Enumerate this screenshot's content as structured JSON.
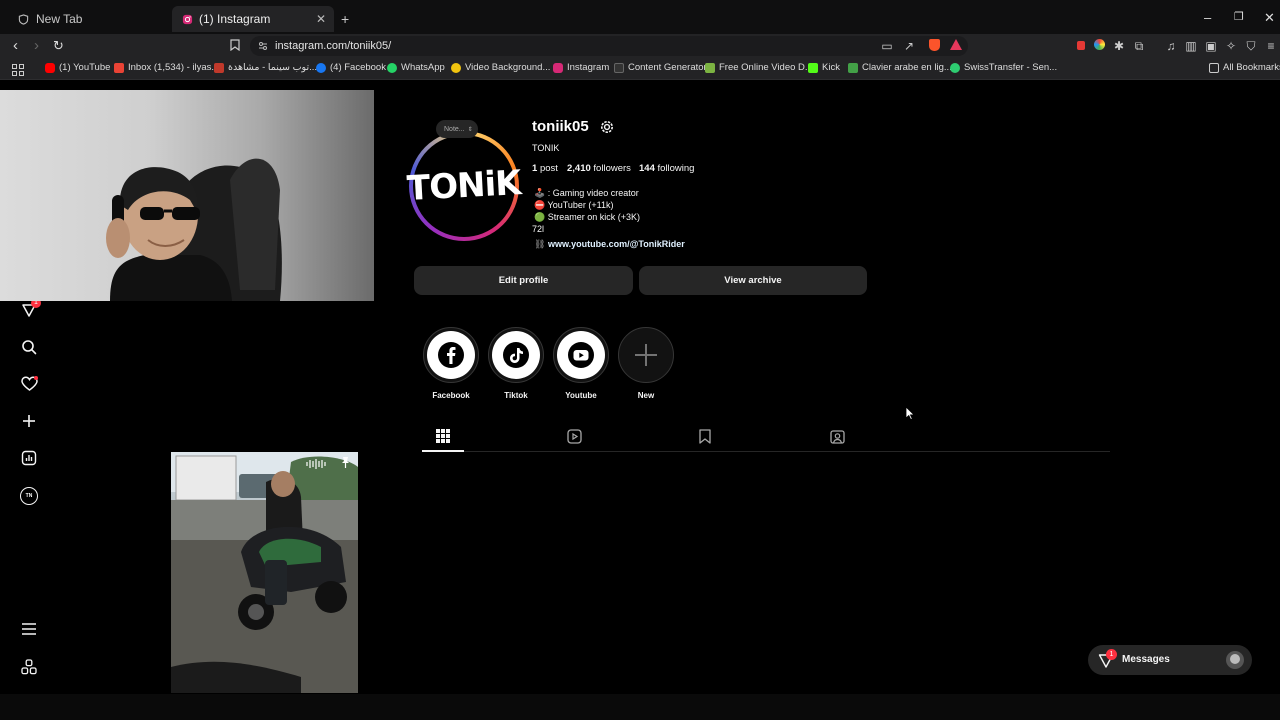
{
  "browser": {
    "tabs": [
      {
        "label": "New Tab",
        "icon": "shield-icon"
      },
      {
        "label": "(1) Instagram",
        "icon": "instagram-icon",
        "active": true
      }
    ],
    "url": "instagram.com/toniik05/",
    "bookmarks": [
      {
        "label": "(1) YouTube",
        "color": "#ff0000"
      },
      {
        "label": "Inbox (1,534) - ilyas...",
        "color": "#ea4335"
      },
      {
        "label": "توب سينما - مشاهدة...",
        "color": "#c0392b"
      },
      {
        "label": "(4) Facebook",
        "color": "#1877f2"
      },
      {
        "label": "WhatsApp",
        "color": "#25d366"
      },
      {
        "label": "Video Background...",
        "color": "#f1c40f"
      },
      {
        "label": "Instagram",
        "color": "#d62976"
      },
      {
        "label": "Content Generator",
        "color": "#333333"
      },
      {
        "label": "Free Online Video D...",
        "color": "#7cb342"
      },
      {
        "label": "Kick",
        "color": "#53fc18"
      },
      {
        "label": "Clavier arabe en lig...",
        "color": "#43a047"
      },
      {
        "label": "SwissTransfer - Sen...",
        "color": "#2ecc71"
      }
    ],
    "all_bookmarks": "All Bookmarks"
  },
  "nav": {
    "notifications_badge": "1",
    "items": [
      "reels-icon",
      "search-icon",
      "heart-icon",
      "create-icon",
      "dashboard-icon",
      "profile-icon",
      "menu-icon",
      "threads-icon"
    ]
  },
  "profile": {
    "note": "Note...",
    "avatar_text": "TONiK",
    "username": "toniik05",
    "full_name": "TONIK",
    "stats": {
      "posts_count": "1",
      "posts_label": "post",
      "followers_count": "2,410",
      "followers_label": "followers",
      "following_count": "144",
      "following_label": "following"
    },
    "bio": [
      "🕹️ : Gaming video creator",
      "⛔ YouTuber (+11k)",
      "🟢 Streamer on kick (+3K)",
      "72l"
    ],
    "link": "www.youtube.com/@TonikRider",
    "edit_button": "Edit profile",
    "archive_button": "View archive"
  },
  "highlights": [
    {
      "label": "Facebook",
      "icon": "facebook-icon"
    },
    {
      "label": "Tiktok",
      "icon": "tiktok-icon"
    },
    {
      "label": "Youtube",
      "icon": "youtube-icon"
    },
    {
      "label": "New",
      "icon": "plus-icon"
    }
  ],
  "messages": {
    "label": "Messages",
    "badge": "1"
  },
  "colors": {
    "accent_link": "#e0f1ff",
    "notification_red": "#ff3040"
  }
}
